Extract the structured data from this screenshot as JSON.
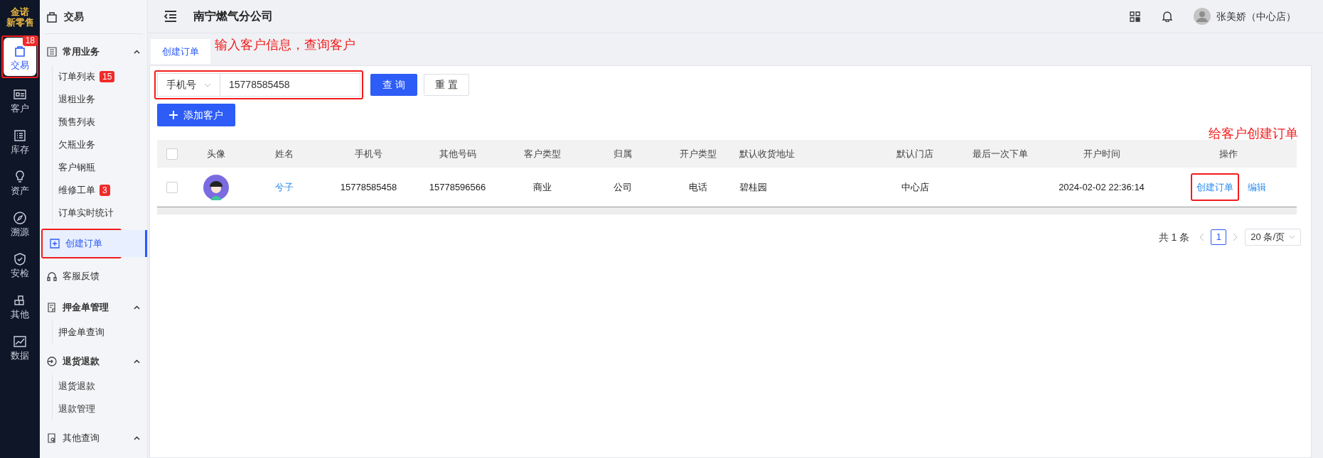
{
  "brand": {
    "line_1": "金诺",
    "line_2": "新零售"
  },
  "rail": [
    {
      "kind": "bag",
      "label": "交易",
      "selected": true,
      "badge": "18"
    },
    {
      "kind": "card",
      "label": "客户",
      "selected": false
    },
    {
      "kind": "list",
      "label": "库存",
      "selected": false
    },
    {
      "kind": "bulb",
      "label": "资产",
      "selected": false
    },
    {
      "kind": "compass",
      "label": "溯源",
      "selected": false
    },
    {
      "kind": "shield",
      "label": "安检",
      "selected": false
    },
    {
      "kind": "blocks",
      "label": "其他",
      "selected": false
    },
    {
      "kind": "chart",
      "label": "数据",
      "selected": false
    }
  ],
  "menu": {
    "title": "交易",
    "groups": [
      {
        "kind": "list",
        "label": "常用业务",
        "expanded": true,
        "children": [
          {
            "label": "订单列表",
            "badge": "15",
            "selected": false
          },
          {
            "label": "退租业务",
            "selected": false
          },
          {
            "label": "预售列表",
            "selected": false
          },
          {
            "label": "欠瓶业务",
            "selected": false
          },
          {
            "label": "客户钢瓶",
            "selected": false
          },
          {
            "label": "维修工单",
            "badge": "3",
            "selected": false
          },
          {
            "label": "订单实时统计",
            "selected": false
          }
        ]
      },
      {
        "kind": "plus",
        "label": "创建订单",
        "selected": true
      },
      {
        "kind": "headset",
        "label": "客服反馈",
        "selected": false
      },
      {
        "kind": "doc",
        "label": "押金单管理",
        "expanded": true,
        "children": [
          {
            "label": "押金单查询",
            "selected": false
          }
        ]
      },
      {
        "kind": "return",
        "label": "退货退款",
        "expanded": true,
        "children": [
          {
            "label": "退货退款",
            "selected": false
          },
          {
            "label": "退款管理",
            "selected": false
          }
        ]
      },
      {
        "kind": "search",
        "label": "其他查询",
        "expanded": true
      }
    ]
  },
  "header": {
    "title": "南宁燃气分公司",
    "user": "张美娇（中心店）"
  },
  "tabs": [
    {
      "label": "创建订单",
      "selected": true
    }
  ],
  "search": {
    "type_select": "手机号",
    "value": "15778585458",
    "buttons": [
      "查 询",
      "重 置"
    ],
    "add_button": "添加客户"
  },
  "table": {
    "select_all": false,
    "columns": [
      "头像",
      "姓名",
      "手机号",
      "其他号码",
      "客户类型",
      "归属",
      "开户类型",
      "默认收货地址",
      "默认门店",
      "最后一次下单",
      "开户时间",
      "操作"
    ],
    "rows": [
      {
        "checked": false,
        "name": "兮子",
        "phone": "15778585458",
        "other_phone": "15778596566",
        "customer_type": "商业",
        "belong": "公司",
        "open_type": "电话",
        "address": "碧桂园",
        "store": "中心店",
        "open_time": "2024-02-02 22:36:14",
        "actions": [
          "创建订单",
          "编辑"
        ]
      }
    ]
  },
  "pagination": {
    "total": "共 1 条",
    "pages": [
      {
        "label": "1",
        "selected": true
      }
    ],
    "page_size": "20 条/页"
  },
  "annotations": [
    "输入客户信息，查询客户",
    "给客户创建订单"
  ]
}
